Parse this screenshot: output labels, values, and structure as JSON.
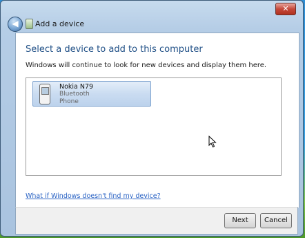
{
  "window": {
    "title": "Add a device"
  },
  "titlebar": {
    "close_glyph": "✕",
    "back_glyph": "◀"
  },
  "main": {
    "heading": "Select a device to add to this computer",
    "instruction": "Windows will continue to look for new devices and display them here.",
    "devices": [
      {
        "name": "Nokia N79",
        "type": "Bluetooth",
        "category": "Phone",
        "icon": "phone-icon"
      }
    ],
    "help_link": "What if Windows doesn't find my device?"
  },
  "buttons": {
    "next": "Next",
    "cancel": "Cancel"
  }
}
